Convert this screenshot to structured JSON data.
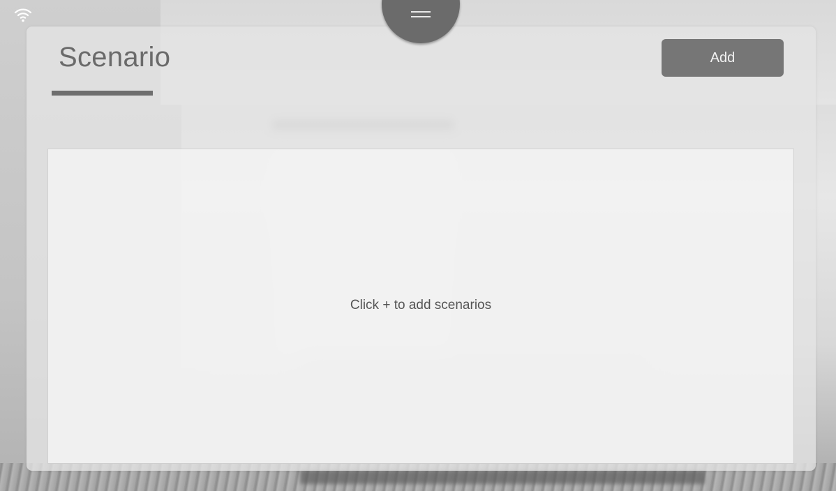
{
  "status_bar": {
    "wifi_icon": "wifi-icon"
  },
  "handle": {
    "icon": "menu-handle-icon"
  },
  "header": {
    "title": "Scenario",
    "add_label": "Add"
  },
  "content": {
    "empty_message": "Click + to add scenarios"
  },
  "colors": {
    "title": "#6a6a6a",
    "button_bg": "#767676",
    "handle_bg": "#6b6b6b"
  }
}
